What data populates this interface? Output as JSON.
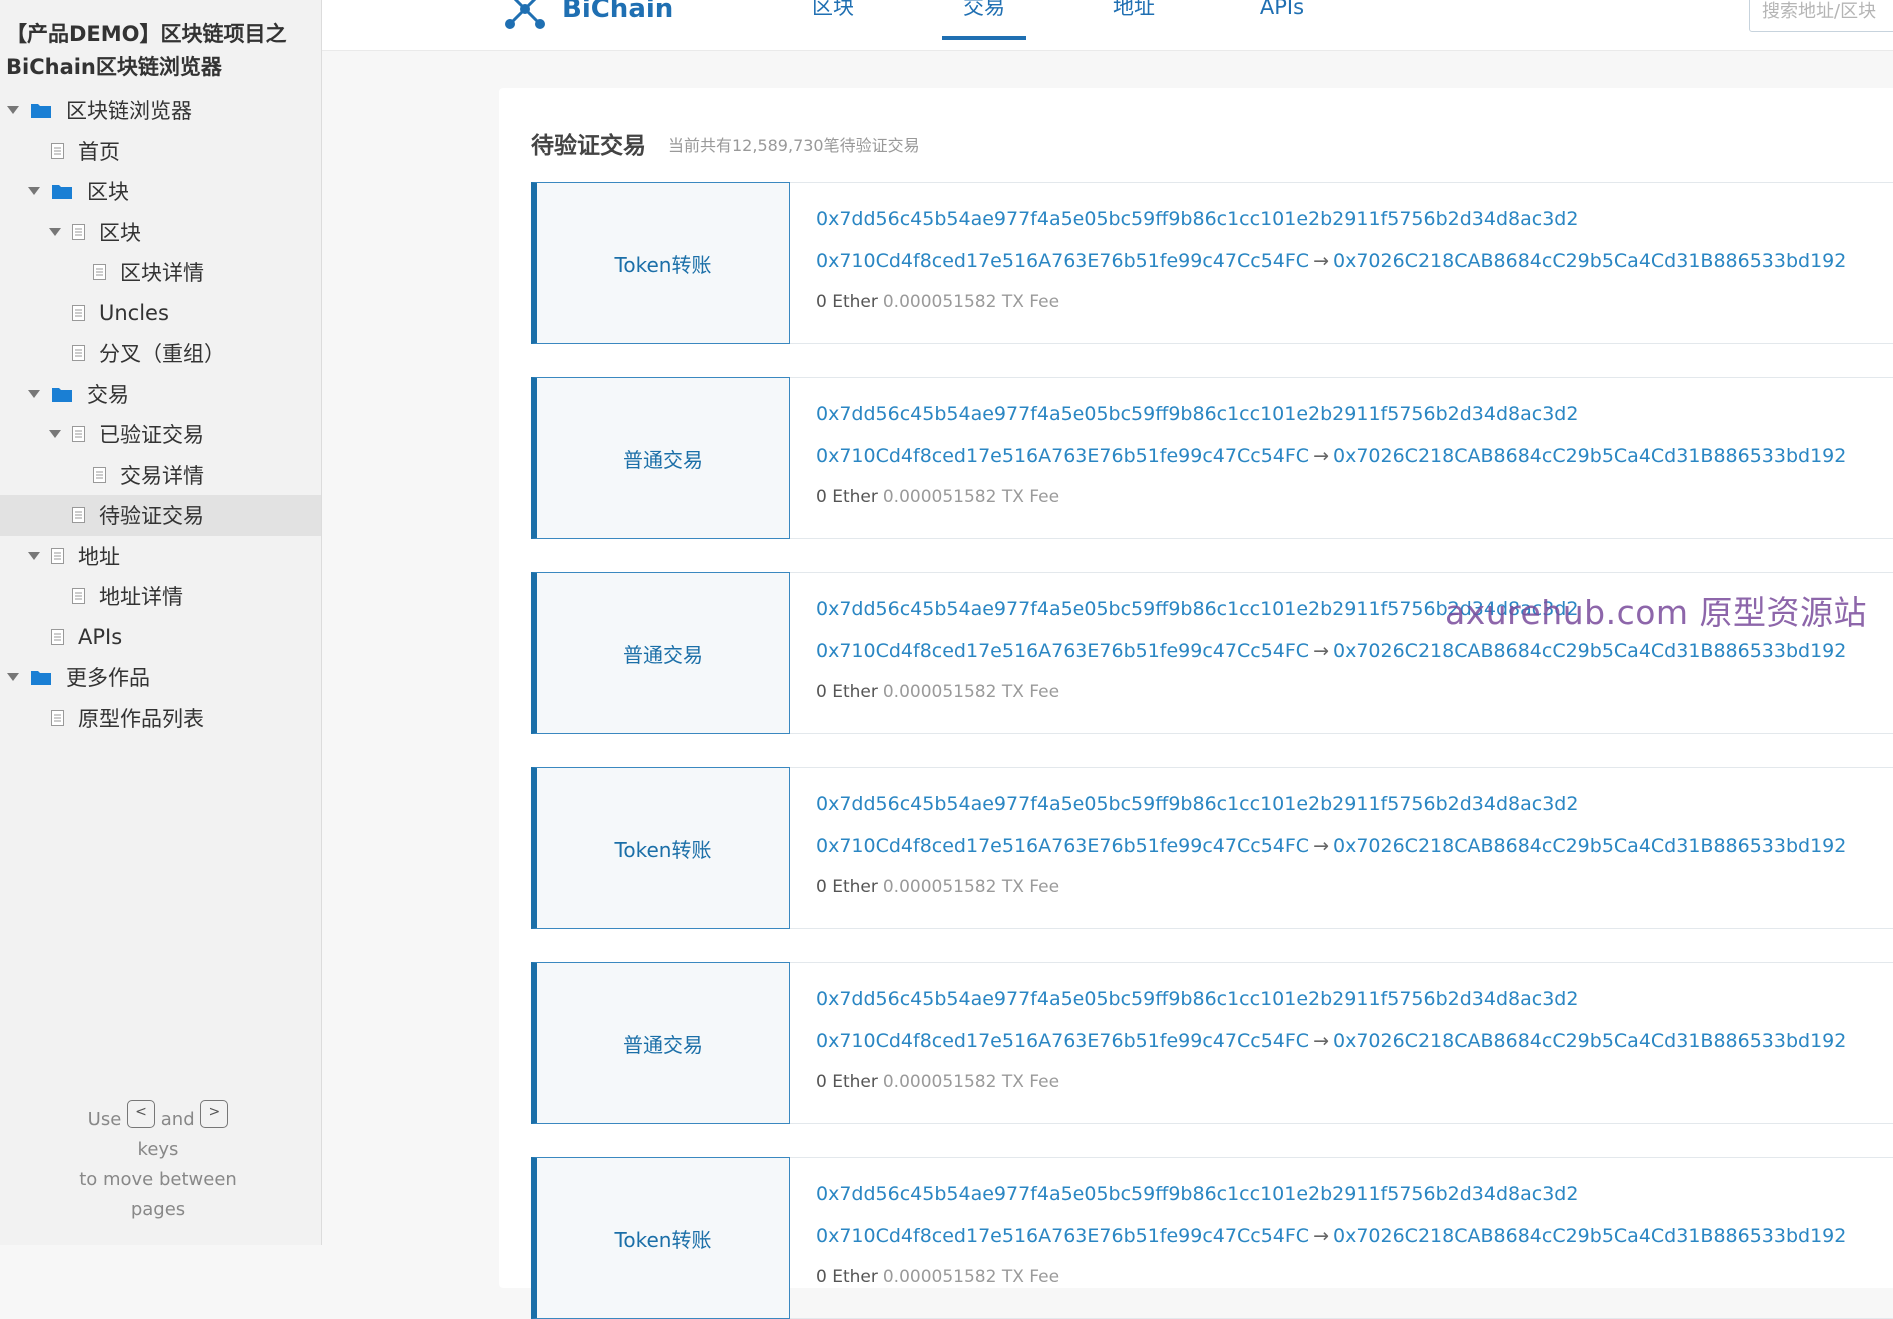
{
  "sidebar": {
    "project_title": "【产品DEMO】区块链项目之BiChain区块链浏览器",
    "items": [
      {
        "label": "区块链浏览器",
        "level": 0,
        "icon": "folder-icon",
        "expanded": true,
        "selected": false
      },
      {
        "label": "首页",
        "level": 1,
        "icon": "page-icon",
        "expanded": false,
        "selected": false
      },
      {
        "label": "区块",
        "level": 1,
        "icon": "folder-icon",
        "expanded": true,
        "selected": false
      },
      {
        "label": "区块",
        "level": 2,
        "icon": "page-icon",
        "expanded": true,
        "selected": false
      },
      {
        "label": "区块详情",
        "level": 3,
        "icon": "page-icon",
        "expanded": false,
        "selected": false
      },
      {
        "label": "Uncles",
        "level": 2,
        "icon": "page-icon",
        "expanded": false,
        "selected": false
      },
      {
        "label": "分叉（重组）",
        "level": 2,
        "icon": "page-icon",
        "expanded": false,
        "selected": false
      },
      {
        "label": "交易",
        "level": 1,
        "icon": "folder-icon",
        "expanded": true,
        "selected": false
      },
      {
        "label": "已验证交易",
        "level": 2,
        "icon": "page-icon",
        "expanded": true,
        "selected": false
      },
      {
        "label": "交易详情",
        "level": 3,
        "icon": "page-icon",
        "expanded": false,
        "selected": false
      },
      {
        "label": "待验证交易",
        "level": 2,
        "icon": "page-icon",
        "expanded": false,
        "selected": true
      },
      {
        "label": "地址",
        "level": 1,
        "icon": "page-icon",
        "expanded": true,
        "selected": false
      },
      {
        "label": "地址详情",
        "level": 2,
        "icon": "page-icon",
        "expanded": false,
        "selected": false
      },
      {
        "label": "APIs",
        "level": 1,
        "icon": "page-icon",
        "expanded": false,
        "selected": false
      },
      {
        "label": "更多作品",
        "level": 0,
        "icon": "folder-icon",
        "expanded": true,
        "selected": false
      },
      {
        "label": "原型作品列表",
        "level": 1,
        "icon": "page-icon",
        "expanded": false,
        "selected": false
      }
    ],
    "help": {
      "use": "Use",
      "prev_key": "<",
      "and": "and",
      "next_key": ">",
      "keys": "keys",
      "to_move": "to move between",
      "pages": "pages"
    }
  },
  "header": {
    "logo_text": "BiChain",
    "nav": [
      {
        "label": "区块",
        "active": false
      },
      {
        "label": "交易",
        "active": true
      },
      {
        "label": "地址",
        "active": false
      },
      {
        "label": "APIs",
        "active": false
      }
    ],
    "search_placeholder": "搜索地址/区块"
  },
  "main": {
    "title": "待验证交易",
    "subtitle": "当前共有12,589,730笔待验证交易",
    "transactions": [
      {
        "type": "Token转账",
        "hash": "0x7dd56c45b54ae977f4a5e05bc59ff9b86c1cc101e2b2911f5756b2d34d8ac3d2",
        "from": "0x710Cd4f8ced17e516A763E76b51fe99c47Cc54FC",
        "arrow": "→",
        "to": "0x7026C218CAB8684cC29b5Ca4Cd31B886533bd192",
        "amount": "0 Ether",
        "fee": "0.000051582 TX Fee"
      },
      {
        "type": "普通交易",
        "hash": "0x7dd56c45b54ae977f4a5e05bc59ff9b86c1cc101e2b2911f5756b2d34d8ac3d2",
        "from": "0x710Cd4f8ced17e516A763E76b51fe99c47Cc54FC",
        "arrow": "→",
        "to": "0x7026C218CAB8684cC29b5Ca4Cd31B886533bd192",
        "amount": "0 Ether",
        "fee": "0.000051582 TX Fee"
      },
      {
        "type": "普通交易",
        "hash": "0x7dd56c45b54ae977f4a5e05bc59ff9b86c1cc101e2b2911f5756b2d34d8ac3d2",
        "from": "0x710Cd4f8ced17e516A763E76b51fe99c47Cc54FC",
        "arrow": "→",
        "to": "0x7026C218CAB8684cC29b5Ca4Cd31B886533bd192",
        "amount": "0 Ether",
        "fee": "0.000051582 TX Fee"
      },
      {
        "type": "Token转账",
        "hash": "0x7dd56c45b54ae977f4a5e05bc59ff9b86c1cc101e2b2911f5756b2d34d8ac3d2",
        "from": "0x710Cd4f8ced17e516A763E76b51fe99c47Cc54FC",
        "arrow": "→",
        "to": "0x7026C218CAB8684cC29b5Ca4Cd31B886533bd192",
        "amount": "0 Ether",
        "fee": "0.000051582 TX Fee"
      },
      {
        "type": "普通交易",
        "hash": "0x7dd56c45b54ae977f4a5e05bc59ff9b86c1cc101e2b2911f5756b2d34d8ac3d2",
        "from": "0x710Cd4f8ced17e516A763E76b51fe99c47Cc54FC",
        "arrow": "→",
        "to": "0x7026C218CAB8684cC29b5Ca4Cd31B886533bd192",
        "amount": "0 Ether",
        "fee": "0.000051582 TX Fee"
      },
      {
        "type": "Token转账",
        "hash": "0x7dd56c45b54ae977f4a5e05bc59ff9b86c1cc101e2b2911f5756b2d34d8ac3d2",
        "from": "0x710Cd4f8ced17e516A763E76b51fe99c47Cc54FC",
        "arrow": "→",
        "to": "0x7026C218CAB8684cC29b5Ca4Cd31B886533bd192",
        "amount": "0 Ether",
        "fee": "0.000051582 TX Fee"
      }
    ]
  },
  "watermark": "axurehub.com 原型资源站",
  "colors": {
    "brand": "#1f6fb2",
    "link": "#2a86c3",
    "folder": "#1a7fd4",
    "watermark": "#7a4c9c"
  }
}
